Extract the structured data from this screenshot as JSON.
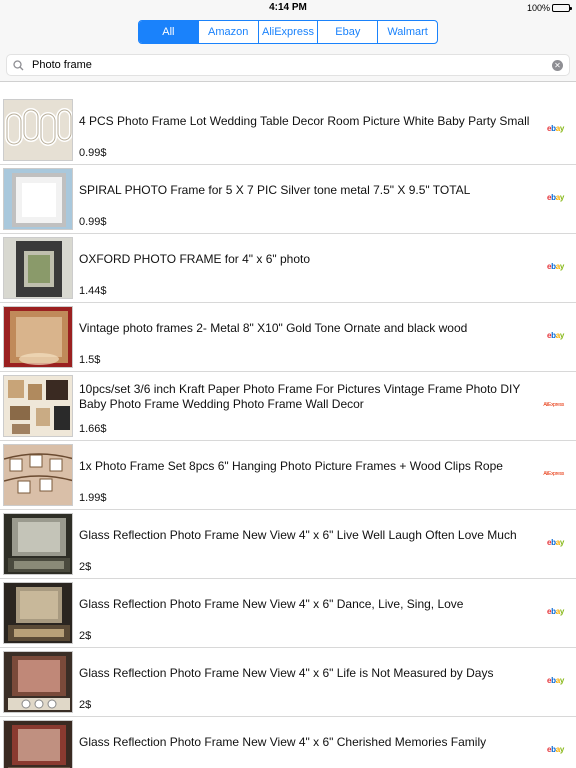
{
  "status": {
    "time": "4:14 PM",
    "battery": "100%"
  },
  "tabs": [
    {
      "label": "All",
      "active": true
    },
    {
      "label": "Amazon",
      "active": false
    },
    {
      "label": "AliExpress",
      "active": false
    },
    {
      "label": "Ebay",
      "active": false
    },
    {
      "label": "Walmart",
      "active": false
    }
  ],
  "search": {
    "value": "Photo frame",
    "placeholder": "Search"
  },
  "colors": {
    "accent": "#1a82fb"
  },
  "results": [
    {
      "title": "4 PCS Photo Frame Lot Wedding Table Decor Room Picture White Baby Party Small",
      "price": "0.99$",
      "store": "ebay"
    },
    {
      "title": "SPIRAL PHOTO Frame for 5 X 7  PIC Silver tone metal  7.5\" X 9.5\" TOTAL",
      "price": "0.99$",
      "store": "ebay"
    },
    {
      "title": "OXFORD PHOTO FRAME for 4\" x 6\" photo",
      "price": "1.44$",
      "store": "ebay"
    },
    {
      "title": "Vintage photo frames 2- Metal 8\" X10\" Gold Tone Ornate and black wood",
      "price": "1.5$",
      "store": "ebay"
    },
    {
      "title": "10pcs/set 3/6 inch Kraft Paper Photo Frame For Pictures Vintage Frame Photo DIY Baby Photo Frame Wedding Photo Frame Wall Decor",
      "price": "1.66$",
      "store": "aliexpress"
    },
    {
      "title": "1x Photo Frame Set 8pcs 6\" Hanging Photo Picture Frames + Wood Clips Rope",
      "price": "1.99$",
      "store": "aliexpress"
    },
    {
      "title": "Glass Reflection Photo Frame New View 4\" x 6\" Live Well Laugh Often Love Much",
      "price": "2$",
      "store": "ebay"
    },
    {
      "title": "Glass Reflection Photo Frame New View 4\" x 6\" Dance, Live, Sing, Love",
      "price": "2$",
      "store": "ebay"
    },
    {
      "title": "Glass Reflection Photo Frame New View 4\" x 6\" Life is Not Measured by Days",
      "price": "2$",
      "store": "ebay"
    },
    {
      "title": "Glass Reflection Photo Frame New View 4\" x 6\" Cherished Memories Family",
      "price": "",
      "store": "ebay"
    }
  ],
  "store_logos": {
    "ebay": "ebay",
    "aliexpress": "AliExpress"
  }
}
